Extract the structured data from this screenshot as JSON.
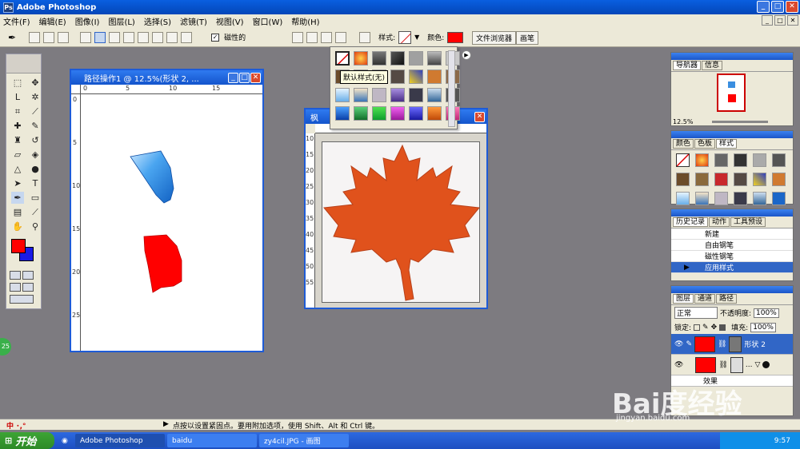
{
  "app": {
    "title": "Adobe Photoshop"
  },
  "menu": [
    "文件(F)",
    "编辑(E)",
    "图像(I)",
    "图层(L)",
    "选择(S)",
    "滤镜(T)",
    "视图(V)",
    "窗口(W)",
    "帮助(H)"
  ],
  "options": {
    "magnetic_label": "磁性的",
    "style_label": "样式:",
    "color_label": "颜色:",
    "color_value": "#ff0000",
    "wells": [
      "文件浏览器",
      "画笔"
    ]
  },
  "flyout": {
    "tooltip": "默认样式(无)"
  },
  "doc1": {
    "title": "路径操作1 @ 12.5%(形状 2, ...",
    "ruler_h": [
      "0",
      "5",
      "10",
      "15"
    ],
    "ruler_v": [
      "0",
      "5",
      "10",
      "15",
      "20",
      "25"
    ]
  },
  "doc2": {
    "title": "枫",
    "ruler_v": [
      "10",
      "15",
      "20",
      "25",
      "30",
      "35",
      "40",
      "45",
      "50",
      "55"
    ]
  },
  "navigator": {
    "tabs": [
      "导航器",
      "信息"
    ],
    "zoom": "12.5%"
  },
  "styles_panel": {
    "tabs": [
      "颜色",
      "色板",
      "样式"
    ]
  },
  "history": {
    "tabs": [
      "历史记录",
      "动作",
      "工具预设"
    ],
    "items": [
      {
        "label": "新建",
        "selected": false
      },
      {
        "label": "自由钢笔",
        "selected": false
      },
      {
        "label": "磁性钢笔",
        "selected": false
      },
      {
        "label": "应用样式",
        "selected": true
      }
    ]
  },
  "layers": {
    "tabs": [
      "图层",
      "通道",
      "路径"
    ],
    "blend_mode": "正常",
    "opacity_label": "不透明度:",
    "opacity": "100%",
    "lock_label": "锁定:",
    "fill_label": "填充:",
    "fill": "100%",
    "rows": [
      {
        "name": "形状 2",
        "selected": true
      },
      {
        "name": "...",
        "selected": false
      }
    ],
    "effect_label": "效果"
  },
  "statusbar": {
    "ime": "中 ･,°",
    "text": "点按以设置紧固点。要用附加选项，使用 Shift、Alt 和 Ctrl 键。"
  },
  "taskbar": {
    "start": "开始",
    "tasks": [
      "Adobe Photoshop",
      "baidu",
      "zy4cil.JPG - 画图"
    ],
    "time": "9:57"
  },
  "watermark": {
    "brand": "Bai度经验",
    "url": "jingyan.baidu.com"
  }
}
